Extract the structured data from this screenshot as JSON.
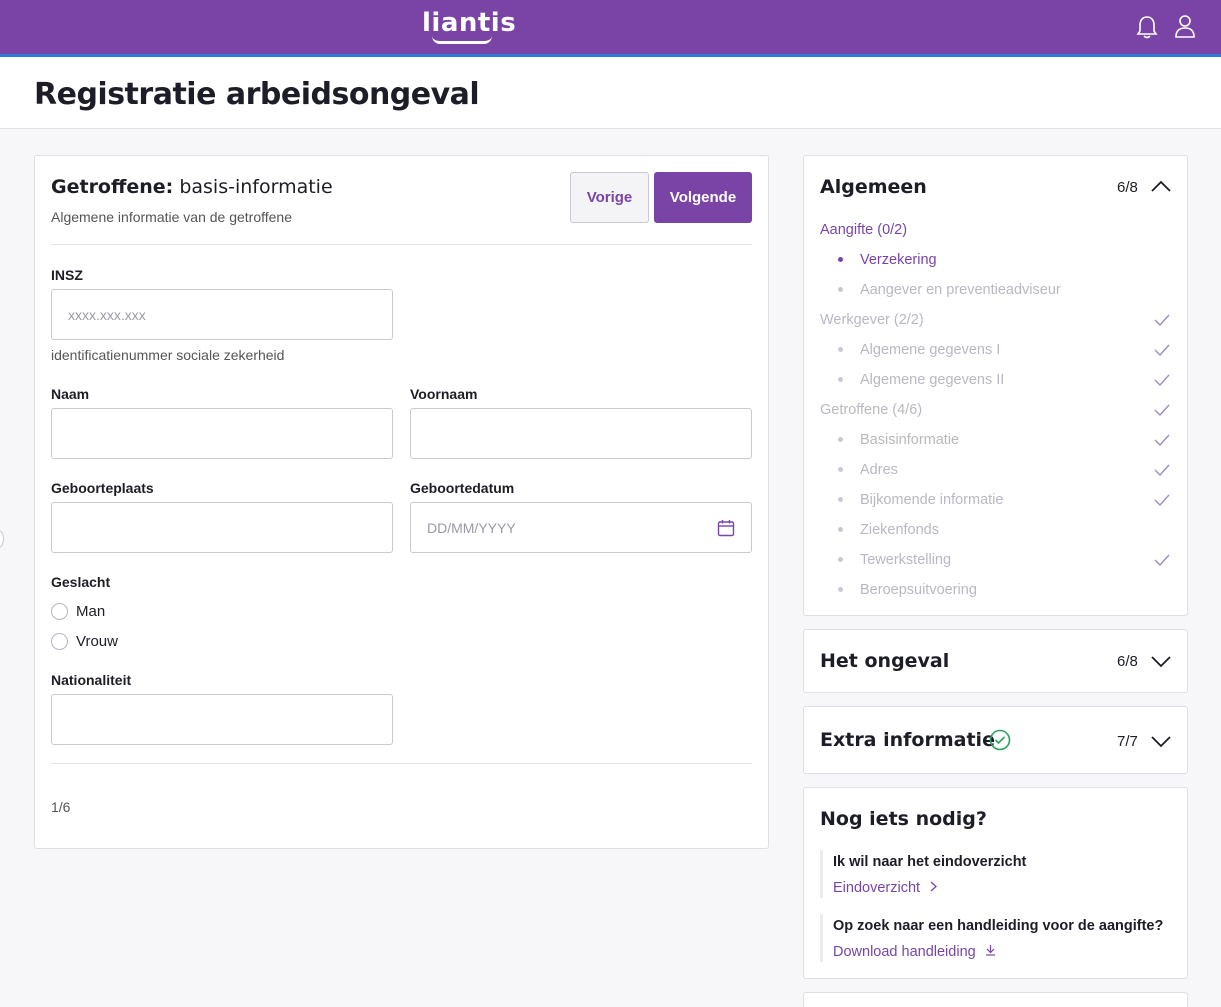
{
  "header": {
    "logo": "liantis",
    "bell_icon": "bell-icon",
    "user_icon": "user-icon"
  },
  "page": {
    "title": "Registratie arbeidsongeval"
  },
  "form": {
    "title_bold": "Getroffene:",
    "title_rest": "basis-informatie",
    "subtitle": "Algemene informatie van de getroffene",
    "prev_label": "Vorige",
    "next_label": "Volgende",
    "insz": {
      "label": "INSZ",
      "placeholder": "xxxx.xxx.xxx",
      "hint": "identificatienummer sociale zekerheid"
    },
    "naam": {
      "label": "Naam",
      "value": ""
    },
    "voornaam": {
      "label": "Voornaam",
      "value": ""
    },
    "geboorteplaats": {
      "label": "Geboorteplaats",
      "value": ""
    },
    "geboortedatum": {
      "label": "Geboortedatum",
      "placeholder": "DD/MM/YYYY"
    },
    "geslacht": {
      "label": "Geslacht",
      "options": [
        "Man",
        "Vrouw"
      ]
    },
    "nationaliteit": {
      "label": "Nationaliteit",
      "value": ""
    },
    "page_indicator": "1/6"
  },
  "sidebar": {
    "algemeen": {
      "title": "Algemeen",
      "count": "6/8",
      "groups": [
        {
          "label": "Aangifte (0/2)",
          "items": [
            "Verzekering",
            "Aangever en preventieadviseur"
          ]
        },
        {
          "label": "Werkgever (2/2)",
          "items": [
            "Algemene gegevens I",
            "Algemene gegevens II"
          ]
        },
        {
          "label": "Getroffene (4/6)",
          "items": [
            "Basisinformatie",
            "Adres",
            "Bijkomende informatie",
            "Ziekenfonds",
            "Tewerkstelling",
            "Beroepsuitvoering"
          ]
        }
      ]
    },
    "ongeval": {
      "title": "Het ongeval",
      "count": "6/8"
    },
    "extra": {
      "title": "Extra informatie",
      "count": "7/7"
    },
    "help": {
      "title": "Nog iets nodig?",
      "q1": "Ik wil naar het eindoverzicht",
      "link1": "Eindoverzicht",
      "q2": "Op zoek naar een handleiding voor de aangifte?",
      "link2": "Download handleiding"
    }
  },
  "colors": {
    "brand": "#7a44a6",
    "success": "#2aa15a",
    "muted": "#b8b8c2"
  }
}
